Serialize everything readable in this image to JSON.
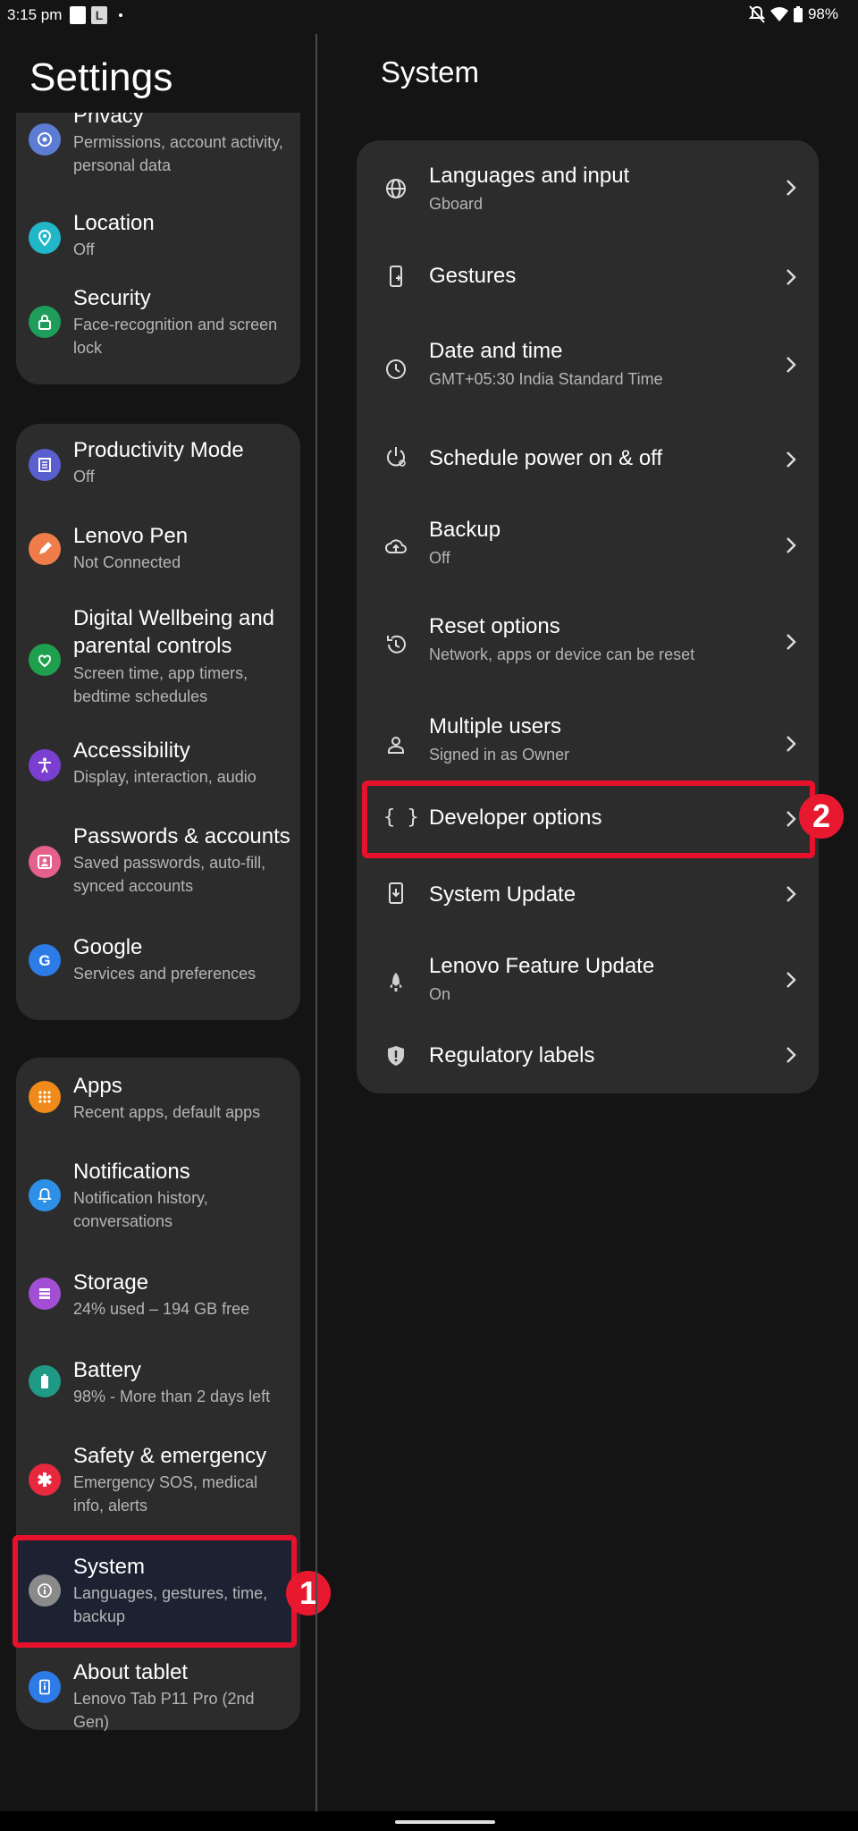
{
  "status_bar": {
    "time": "3:15 pm",
    "notif_letter": "L",
    "battery": "98%"
  },
  "left": {
    "title": "Settings",
    "cards": [
      {
        "items": [
          {
            "title": "Privacy",
            "subtitle": "Permissions, account activity, personal data",
            "icon": "privacy-icon",
            "color": "#5c7cd4"
          },
          {
            "title": "Location",
            "subtitle": "Off",
            "icon": "location-icon",
            "color": "#22b6c9"
          },
          {
            "title": "Security",
            "subtitle": "Face-recognition and screen lock",
            "icon": "lock-icon",
            "color": "#1f9d5a"
          }
        ]
      },
      {
        "items": [
          {
            "title": "Productivity Mode",
            "subtitle": "Off",
            "icon": "productivity-icon",
            "color": "#5a5fd0"
          },
          {
            "title": "Lenovo Pen",
            "subtitle": "Not Connected",
            "icon": "pen-icon",
            "color": "#ef7d4a"
          },
          {
            "title": "Digital Wellbeing and parental controls",
            "subtitle": "Screen time, app timers, bedtime schedules",
            "icon": "wellbeing-icon",
            "color": "#1fa04e"
          },
          {
            "title": "Accessibility",
            "subtitle": "Display, interaction, audio",
            "icon": "accessibility-icon",
            "color": "#7a3fd0"
          },
          {
            "title": "Passwords & accounts",
            "subtitle": "Saved passwords, auto-fill, synced accounts",
            "icon": "accounts-icon",
            "color": "#e5608a"
          },
          {
            "title": "Google",
            "subtitle": "Services and preferences",
            "icon": "google-icon",
            "color": "#2d7be6"
          }
        ]
      },
      {
        "items": [
          {
            "title": "Apps",
            "subtitle": "Recent apps, default apps",
            "icon": "apps-icon",
            "color": "#f08a1a"
          },
          {
            "title": "Notifications",
            "subtitle": "Notification history, conversations",
            "icon": "bell-icon",
            "color": "#2d8fe6"
          },
          {
            "title": "Storage",
            "subtitle": "24% used – 194 GB free",
            "icon": "storage-icon",
            "color": "#a24fd6"
          },
          {
            "title": "Battery",
            "subtitle": "98% - More than 2 days left",
            "icon": "battery-icon",
            "color": "#1f9b85"
          },
          {
            "title": "Safety & emergency",
            "subtitle": "Emergency SOS, medical info, alerts",
            "icon": "emergency-icon",
            "color": "#e8283d"
          },
          {
            "title": "System",
            "subtitle": "Languages, gestures, time, backup",
            "icon": "info-icon",
            "color": "#8a8a8a"
          },
          {
            "title": "About tablet",
            "subtitle": "Lenovo Tab P11 Pro (2nd Gen)",
            "icon": "tablet-icon",
            "color": "#2d7be6"
          }
        ]
      }
    ]
  },
  "right": {
    "title": "System",
    "items": [
      {
        "title": "Languages and input",
        "subtitle": "Gboard",
        "icon": "globe-icon"
      },
      {
        "title": "Gestures",
        "subtitle": "",
        "icon": "gestures-icon"
      },
      {
        "title": "Date and time",
        "subtitle": "GMT+05:30 India Standard Time",
        "icon": "clock-icon"
      },
      {
        "title": "Schedule power on & off",
        "subtitle": "",
        "icon": "schedule-power-icon"
      },
      {
        "title": "Backup",
        "subtitle": "Off",
        "icon": "cloud-upload-icon"
      },
      {
        "title": "Reset options",
        "subtitle": "Network, apps or device can be reset",
        "icon": "reset-icon"
      },
      {
        "title": "Multiple users",
        "subtitle": "Signed in as Owner",
        "icon": "user-icon"
      },
      {
        "title": "Developer options",
        "subtitle": "",
        "icon": "braces-icon"
      },
      {
        "title": "System Update",
        "subtitle": "",
        "icon": "system-update-icon"
      },
      {
        "title": "Lenovo Feature Update",
        "subtitle": "On",
        "icon": "rocket-icon"
      },
      {
        "title": "Regulatory labels",
        "subtitle": "",
        "icon": "shield-icon"
      }
    ]
  },
  "annotations": {
    "badge1": "1",
    "badge2": "2"
  }
}
